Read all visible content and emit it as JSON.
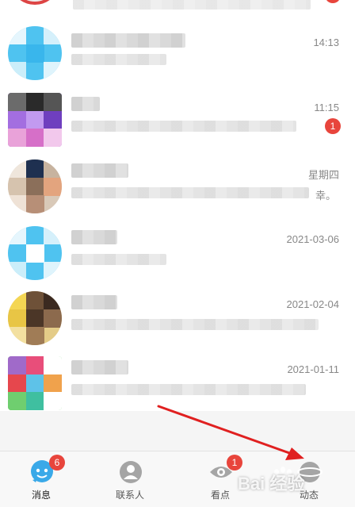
{
  "chats": [
    {
      "time": "",
      "badge": ""
    },
    {
      "time": "14:13",
      "badge": ""
    },
    {
      "time": "11:15",
      "badge": "1"
    },
    {
      "time": "星期四",
      "extra": "幸。",
      "badge": ""
    },
    {
      "time": "2021-03-06",
      "badge": ""
    },
    {
      "time": "2021-02-04",
      "badge": ""
    },
    {
      "time": "2021-01-11",
      "badge": ""
    }
  ],
  "tabbar": {
    "messages": {
      "label": "消息",
      "badge": "6"
    },
    "contacts": {
      "label": "联系人"
    },
    "discover": {
      "label": "看点",
      "badge": "1"
    },
    "dynamic": {
      "label": "动态"
    }
  },
  "watermark": {
    "text": "Bai 经验",
    "icon": "paw-icon"
  },
  "colors": {
    "badge": "#e8453c",
    "accent": "#1296db",
    "arrow": "#e02020"
  }
}
